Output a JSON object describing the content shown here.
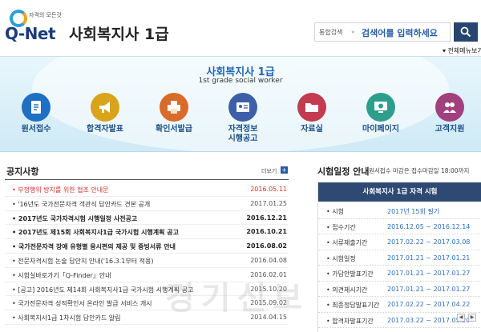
{
  "header": {
    "logo_small": "자격의 모든것",
    "logo_main": "Q-Net",
    "title": "사회복지사 1급",
    "search": {
      "select": "통합검색",
      "placeholder": "검색어를 입력하세요"
    },
    "all_menu": "전체메뉴보기"
  },
  "banner": {
    "title": "사회복지사 1급",
    "subtitle": "1st grade social worker",
    "menu": [
      {
        "label": "원서접수",
        "icon": "document-icon",
        "color": "#1f6fc2"
      },
      {
        "label": "합격자발표",
        "icon": "megaphone-icon",
        "color": "#d9a41a"
      },
      {
        "label": "확인서발급",
        "icon": "printer-icon",
        "color": "#d86a2a"
      },
      {
        "label": "자격정보\n시행공고",
        "icon": "id-card-icon",
        "color": "#3c5fa8"
      },
      {
        "label": "자료실",
        "icon": "folder-icon",
        "color": "#c23b4e"
      },
      {
        "label": "마이페이지",
        "icon": "monitor-icon",
        "color": "#2e9e8c"
      },
      {
        "label": "고객지원",
        "icon": "support-icon",
        "color": "#a23f7e"
      }
    ]
  },
  "notices": {
    "title": "공지사항",
    "more": "더보기",
    "items": [
      {
        "text": "부정행위 방지를 위한 협조 안내문",
        "date": "2016.05.11",
        "style": "red"
      },
      {
        "text": "'16년도 국가전문자격 객관식 답안카드 견본 공개",
        "date": "2017.01.25",
        "style": ""
      },
      {
        "text": "2017년도 국가자격시험 시행일정 사전공고",
        "date": "2016.12.21",
        "style": "bold"
      },
      {
        "text": "2017년도 제15회 사회복지사1급 국가시험 시행계획 공고",
        "date": "2016.10.21",
        "style": "bold"
      },
      {
        "text": "국가전문자격 장애 유형별 응시편의 제공 및 증빙서류 안내",
        "date": "2016.08.02",
        "style": "bold"
      },
      {
        "text": "전문자격시험 논술 답안지 안내('16.3.1부터 적용)",
        "date": "2016.04.08",
        "style": ""
      },
      {
        "text": "시험실바로가기「Q-Finder」안내",
        "date": "2016.02.01",
        "style": ""
      },
      {
        "text": "[공고] 2016년도 제14회 사회복지사1급 국가시험 시행계획 공고",
        "date": "2015.10.20",
        "style": ""
      },
      {
        "text": "국가전문자격 성적확인서 온라인 발급 서비스 개시",
        "date": "2015.09.02",
        "style": ""
      },
      {
        "text": "사회복지사1급 1차시험 답안카드 알림",
        "date": "2014.04.15",
        "style": ""
      }
    ]
  },
  "schedule": {
    "title": "시험일정 안내",
    "note": "원서접수 마감은 접수마감일 18:00까지",
    "panel_title": "사회복지사 1급 자격 시험",
    "rows": [
      {
        "label": "시험",
        "value": "2017년 15회 필기"
      },
      {
        "label": "접수기간",
        "value": "2016.12.05 ~ 2016.12.14"
      },
      {
        "label": "서류제출기간",
        "value": "2017.02.22 ~ 2017.03.08"
      },
      {
        "label": "시험일정",
        "value": "2017.01.21 ~ 2017.01.21"
      },
      {
        "label": "가답안발표기간",
        "value": "2017.01.21 ~ 2017.01.27"
      },
      {
        "label": "의견제시기간",
        "value": "2017.01.21 ~ 2017.01.27"
      },
      {
        "label": "최종정답발표기간",
        "value": "2017.02.22 ~ 2017.04.22"
      },
      {
        "label": "합격자발표기간",
        "value": "2017.03.22 ~ 2017.05.20"
      }
    ]
  },
  "watermark": "경기신보"
}
